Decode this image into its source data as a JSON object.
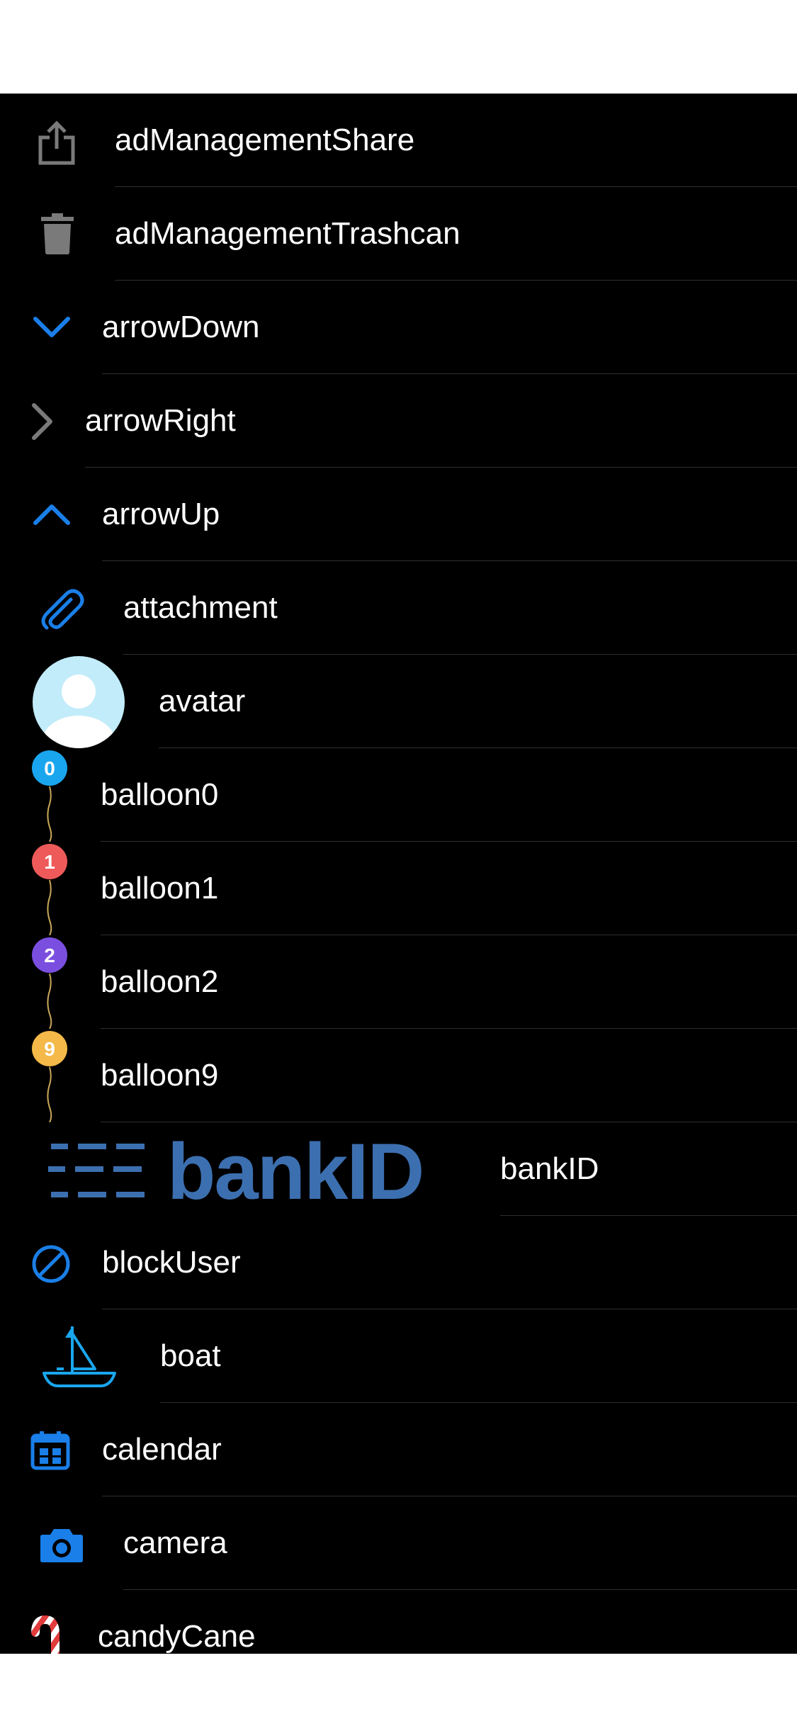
{
  "items": [
    {
      "label": "adManagementShare",
      "icon": "share-icon"
    },
    {
      "label": "adManagementTrashcan",
      "icon": "trashcan-icon"
    },
    {
      "label": "arrowDown",
      "icon": "arrow-down-icon"
    },
    {
      "label": "arrowRight",
      "icon": "arrow-right-icon"
    },
    {
      "label": "arrowUp",
      "icon": "arrow-up-icon"
    },
    {
      "label": "attachment",
      "icon": "paperclip-icon"
    },
    {
      "label": "avatar",
      "icon": "avatar-icon"
    },
    {
      "label": "balloon0",
      "icon": "balloon-icon",
      "badge": "0"
    },
    {
      "label": "balloon1",
      "icon": "balloon-icon",
      "badge": "1"
    },
    {
      "label": "balloon2",
      "icon": "balloon-icon",
      "badge": "2"
    },
    {
      "label": "balloon9",
      "icon": "balloon-icon",
      "badge": "9"
    },
    {
      "label": "bankID",
      "icon": "bankid-logo"
    },
    {
      "label": "blockUser",
      "icon": "block-icon"
    },
    {
      "label": "boat",
      "icon": "boat-icon"
    },
    {
      "label": "calendar",
      "icon": "calendar-icon"
    },
    {
      "label": "camera",
      "icon": "camera-icon"
    },
    {
      "label": "candyCane",
      "icon": "candy-cane-icon"
    }
  ],
  "bankid_logo_text": "bankID",
  "colors": {
    "background": "#000000",
    "text": "#ffffff",
    "separator": "#2e2e2e",
    "blue": "#1a7fe8",
    "gray": "#7a7a7a",
    "balloon0": "#1aa6ee",
    "balloon1": "#ee5a5a",
    "balloon2": "#7a4fe0",
    "balloon9": "#f4b948",
    "bankid": "#3c6fb0",
    "avatar_bg": "#c2ecf9",
    "boat": "#1aa6ee"
  }
}
